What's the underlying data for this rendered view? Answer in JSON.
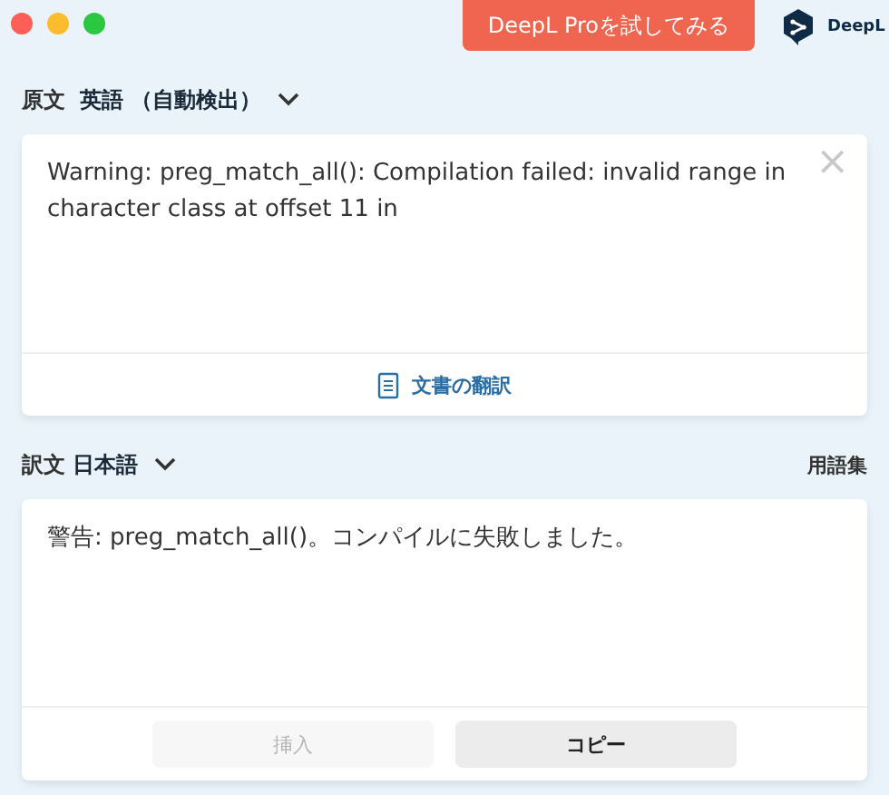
{
  "header": {
    "pro_button": "DeepL Proを試してみる",
    "logo_text": "DeepL"
  },
  "source": {
    "label": "原文",
    "language": "英語 （自動検出）",
    "text": "Warning: preg_match_all(): Compilation failed: invalid range in character class at offset 11 in",
    "clear": "×",
    "document_button": "文書の翻訳"
  },
  "target": {
    "label": "訳文",
    "language": "日本語",
    "glossary": "用語集",
    "text": "警告: preg_match_all()。コンパイルに失敗しました。",
    "buttons": [
      {
        "label": "挿入",
        "disabled": true
      },
      {
        "label": "コピー",
        "disabled": false
      }
    ]
  }
}
